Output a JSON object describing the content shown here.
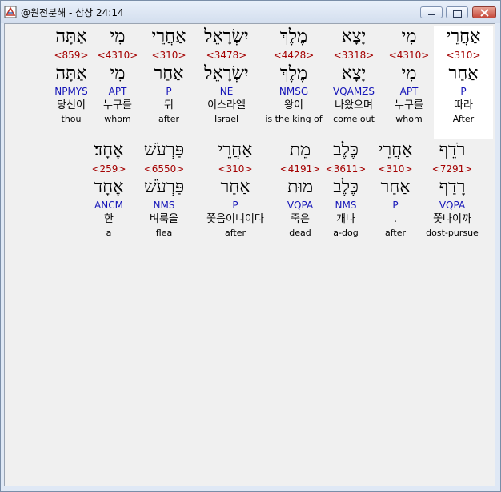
{
  "window": {
    "title": "@원전분해 - 삼상 24:14"
  },
  "lines": [
    {
      "words": [
        {
          "heb": "אַחֲרֵי",
          "strong": "<310>",
          "lemma": "אַחַר",
          "parse": "P",
          "ko": "따라",
          "en": "After",
          "selected": true
        },
        {
          "heb": "מִי",
          "strong": "<4310>",
          "lemma": "מִי",
          "parse": "APT",
          "ko": "누구를",
          "en": "whom"
        },
        {
          "heb": "יָצָא",
          "strong": "<3318>",
          "lemma": "יָצָא",
          "parse": "VQAMZS",
          "ko": "나왔으며",
          "en": "come out"
        },
        {
          "heb": "מֶלֶךְ",
          "strong": "<4428>",
          "lemma": "מֶלֶךְ",
          "parse": "NMSG",
          "ko": "왕이",
          "en": "is the king of"
        },
        {
          "heb": "יִשְׂרָאֵל",
          "strong": "<3478>",
          "lemma": "יִשְׂרָאֵל",
          "parse": "NE",
          "ko": "이스라엘",
          "en": "Israel"
        },
        {
          "heb": "אַחֲרֵי",
          "strong": "<310>",
          "lemma": "אַחַר",
          "parse": "P",
          "ko": "뒤",
          "en": "after"
        },
        {
          "heb": "מִי",
          "strong": "<4310>",
          "lemma": "מִי",
          "parse": "APT",
          "ko": "누구를",
          "en": "whom"
        },
        {
          "heb": "אַתָּה",
          "strong": "<859>",
          "lemma": "אַתָּה",
          "parse": "NPMYS",
          "ko": "당신이",
          "en": "thou"
        }
      ]
    },
    {
      "words": [
        {
          "heb": "רֹדֵף",
          "strong": "<7291>",
          "lemma": "רָדַף",
          "parse": "VQPA",
          "ko": "쫓나이까",
          "en": "dost-pursue"
        },
        {
          "heb": "אַחֲרֵי",
          "strong": "<310>",
          "lemma": "אַחַר",
          "parse": "P",
          "ko": ".",
          "en": "after"
        },
        {
          "heb": "כֶּלֶב",
          "strong": "<3611>",
          "lemma": "כֶּלֶב",
          "parse": "NMS",
          "ko": "개나",
          "en": "a-dog"
        },
        {
          "heb": "מֵת",
          "strong": "<4191>",
          "lemma": "מוּת",
          "parse": "VQPA",
          "ko": "죽은",
          "en": "dead"
        },
        {
          "heb": "אַחֲרֵי",
          "strong": "<310>",
          "lemma": "אַחַר",
          "parse": "P",
          "ko": "쫓음이니이다",
          "en": "after"
        },
        {
          "heb": "פַּרְעֹשׁ",
          "strong": "<6550>",
          "lemma": "פַּרְעֹשׁ",
          "parse": "NMS",
          "ko": "벼룩을",
          "en": "flea"
        },
        {
          "heb": "אֶחָד׃",
          "strong": "<259>",
          "lemma": "אֶחָד",
          "parse": "ANCM",
          "ko": "한",
          "en": "a"
        }
      ]
    }
  ]
}
